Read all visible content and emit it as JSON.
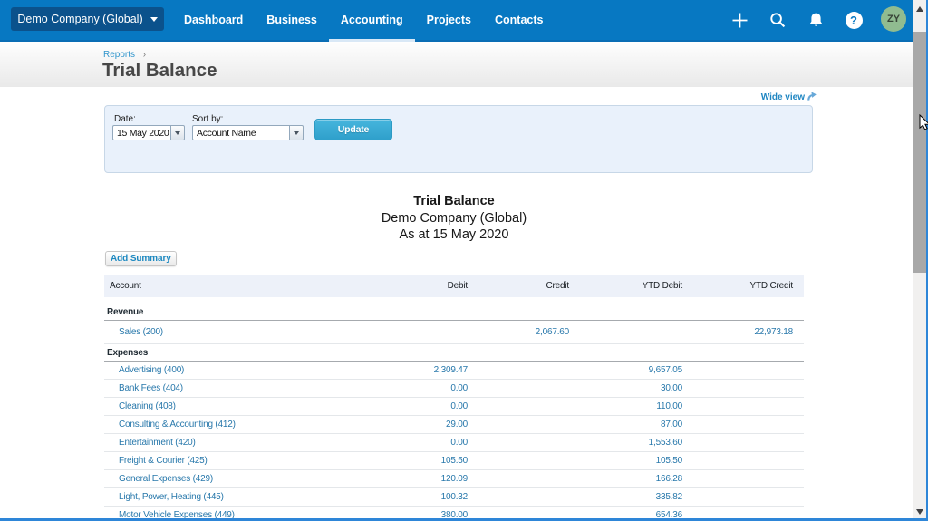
{
  "nav": {
    "company_selector": {
      "label": "Demo Company (Global)"
    },
    "items": [
      {
        "label": "Dashboard",
        "active": false
      },
      {
        "label": "Business",
        "active": false
      },
      {
        "label": "Accounting",
        "active": true
      },
      {
        "label": "Projects",
        "active": false
      },
      {
        "label": "Contacts",
        "active": false
      }
    ],
    "avatar_initials": "ZY",
    "help_glyph": "?"
  },
  "breadcrumb": {
    "parent": "Reports",
    "separator": "›"
  },
  "page": {
    "title": "Trial Balance",
    "wide_view_label": "Wide view"
  },
  "filters": {
    "date": {
      "label": "Date:",
      "value": "15 May 2020"
    },
    "sort": {
      "label": "Sort by:",
      "value": "Account Name"
    },
    "update_label": "Update"
  },
  "report": {
    "title": "Trial Balance",
    "company": "Demo Company (Global)",
    "as_at": "As at 15 May 2020",
    "add_summary_label": "Add Summary"
  },
  "table": {
    "columns": [
      "Account",
      "Debit",
      "Credit",
      "YTD Debit",
      "YTD Credit"
    ],
    "sections": {
      "revenue": "Revenue",
      "expenses": "Expenses"
    },
    "rows": [
      {
        "account": "Sales (200)",
        "debit": "",
        "credit": "2,067.60",
        "ytd_debit": "",
        "ytd_credit": "22,973.18"
      },
      {
        "account": "Advertising (400)",
        "debit": "2,309.47",
        "credit": "",
        "ytd_debit": "9,657.05",
        "ytd_credit": ""
      },
      {
        "account": "Bank Fees (404)",
        "debit": "0.00",
        "credit": "",
        "ytd_debit": "30.00",
        "ytd_credit": ""
      },
      {
        "account": "Cleaning (408)",
        "debit": "0.00",
        "credit": "",
        "ytd_debit": "110.00",
        "ytd_credit": ""
      },
      {
        "account": "Consulting & Accounting (412)",
        "debit": "29.00",
        "credit": "",
        "ytd_debit": "87.00",
        "ytd_credit": ""
      },
      {
        "account": "Entertainment (420)",
        "debit": "0.00",
        "credit": "",
        "ytd_debit": "1,553.60",
        "ytd_credit": ""
      },
      {
        "account": "Freight & Courier (425)",
        "debit": "105.50",
        "credit": "",
        "ytd_debit": "105.50",
        "ytd_credit": ""
      },
      {
        "account": "General Expenses (429)",
        "debit": "120.09",
        "credit": "",
        "ytd_debit": "166.28",
        "ytd_credit": ""
      },
      {
        "account": "Light, Power, Heating (445)",
        "debit": "100.32",
        "credit": "",
        "ytd_debit": "335.82",
        "ytd_credit": ""
      },
      {
        "account": "Motor Vehicle Expenses (449)",
        "debit": "380.00",
        "credit": "",
        "ytd_debit": "654.36",
        "ytd_credit": ""
      }
    ]
  },
  "colors": {
    "nav_blue": "#0778C2",
    "company_btn_blue": "#0B528C",
    "active_tab_underline": "#D9E8F6",
    "avatar_green": "#90BC90",
    "link_blue": "#2878AB",
    "update_btn_blue": "#38A9D3",
    "filter_panel_bg": "#E9F1FB",
    "table_header_bg": "#EDF1F9",
    "window_edge_blue": "#2E86D8"
  }
}
